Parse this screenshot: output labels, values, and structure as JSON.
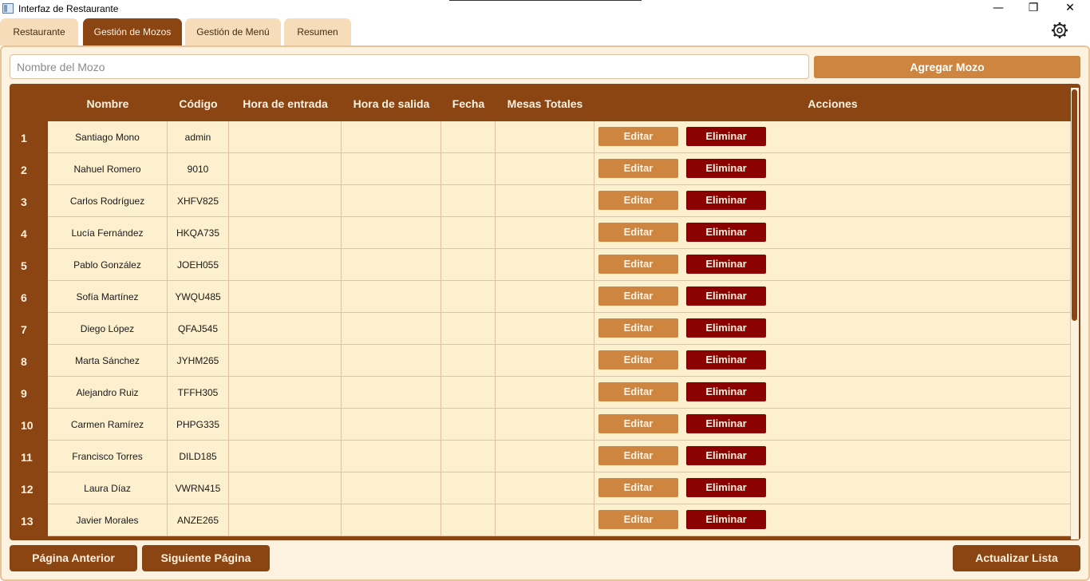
{
  "window": {
    "title": "Interfaz de Restaurante",
    "minimize": "—",
    "restore": "❐",
    "close": "✕"
  },
  "tabs": [
    {
      "label": "Restaurante",
      "active": false
    },
    {
      "label": "Gestión de Mozos",
      "active": true
    },
    {
      "label": "Gestión de Menú",
      "active": false
    },
    {
      "label": "Resumen",
      "active": false
    }
  ],
  "settings_icon": "gear-icon",
  "form": {
    "name_placeholder": "Nombre del Mozo",
    "name_value": "",
    "add_label": "Agregar Mozo"
  },
  "table": {
    "headers": [
      "Nombre",
      "Código",
      "Hora de entrada",
      "Hora de salida",
      "Fecha",
      "Mesas Totales",
      "Acciones"
    ],
    "edit_label": "Editar",
    "delete_label": "Eliminar",
    "rows": [
      {
        "num": "1",
        "nombre": "Santiago Mono",
        "codigo": "admin"
      },
      {
        "num": "2",
        "nombre": "Nahuel Romero",
        "codigo": "9010"
      },
      {
        "num": "3",
        "nombre": "Carlos Rodríguez",
        "codigo": "XHFV825"
      },
      {
        "num": "4",
        "nombre": "Lucía Fernández",
        "codigo": "HKQA735"
      },
      {
        "num": "5",
        "nombre": "Pablo González",
        "codigo": "JOEH055"
      },
      {
        "num": "6",
        "nombre": "Sofía Martínez",
        "codigo": "YWQU485"
      },
      {
        "num": "7",
        "nombre": "Diego López",
        "codigo": "QFAJ545"
      },
      {
        "num": "8",
        "nombre": "Marta Sánchez",
        "codigo": "JYHM265"
      },
      {
        "num": "9",
        "nombre": "Alejandro Ruiz",
        "codigo": "TFFH305"
      },
      {
        "num": "10",
        "nombre": "Carmen Ramírez",
        "codigo": "PHPG335"
      },
      {
        "num": "11",
        "nombre": "Francisco Torres",
        "codigo": "DILD185"
      },
      {
        "num": "12",
        "nombre": "Laura Díaz",
        "codigo": "VWRN415"
      },
      {
        "num": "13",
        "nombre": "Javier Morales",
        "codigo": "ANZE265"
      }
    ]
  },
  "footer": {
    "prev_label": "Página Anterior",
    "next_label": "Siguiente Página",
    "refresh_label": "Actualizar Lista"
  },
  "colors": {
    "primary": "#8b4513",
    "accent": "#cd853f",
    "danger": "#8b0000",
    "cell_bg": "#fdf0cf",
    "panel_bg": "#fdf1e0"
  }
}
